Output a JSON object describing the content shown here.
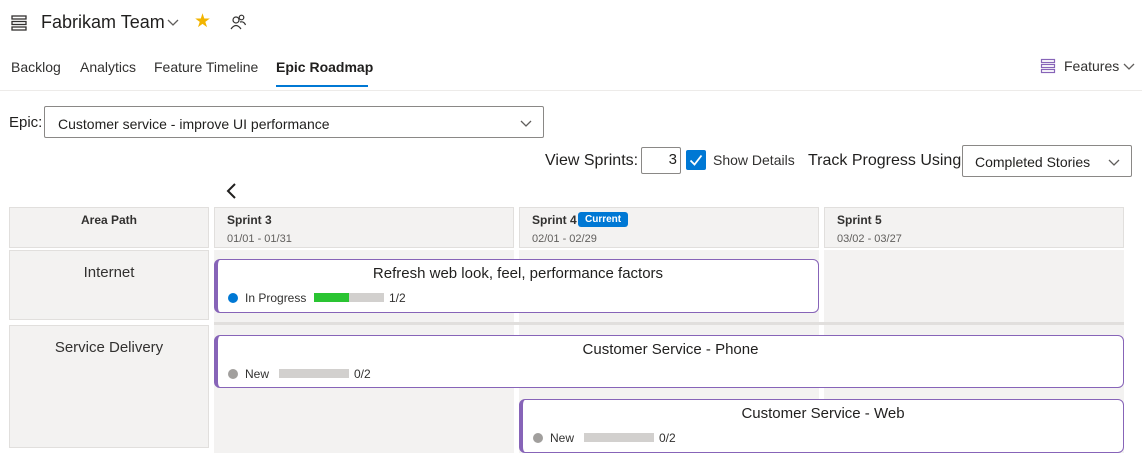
{
  "header": {
    "team_name": "Fabrikam Team",
    "tabs": [
      {
        "label": "Backlog",
        "active": false
      },
      {
        "label": "Analytics",
        "active": false
      },
      {
        "label": "Feature Timeline",
        "active": false
      },
      {
        "label": "Epic Roadmap",
        "active": true
      }
    ],
    "features_label": "Features",
    "icons": {
      "team": "backlog-list-icon",
      "favorite": "star-icon",
      "members": "people-icon",
      "features": "features-list-icon"
    },
    "accent_color": "#0078d4"
  },
  "epic": {
    "label": "Epic:",
    "selected": "Customer service - improve UI performance"
  },
  "controls": {
    "view_sprints_label": "View Sprints:",
    "view_sprints_value": "3",
    "show_details_checked": true,
    "show_details_label": "Show Details",
    "track_progress_label": "Track Progress Using:",
    "track_progress_value": "Completed Stories"
  },
  "grid": {
    "area_header": "Area Path",
    "sprints": [
      {
        "name": "Sprint 3",
        "dates": "01/01 - 01/31",
        "current": false
      },
      {
        "name": "Sprint 4",
        "dates": "02/01 - 02/29",
        "current": true,
        "badge": "Current"
      },
      {
        "name": "Sprint 5",
        "dates": "03/02 - 03/27",
        "current": false
      }
    ],
    "areas": [
      {
        "name": "Internet",
        "cards": [
          {
            "title": "Refresh web look, feel, performance factors",
            "state": "In Progress",
            "state_color": "#0078d4",
            "progress": 0.5,
            "progress_text": "1/2"
          }
        ]
      },
      {
        "name": "Service Delivery",
        "cards": [
          {
            "title": "Customer Service - Phone",
            "state": "New",
            "state_color": "#a19f9d",
            "progress": 0.0,
            "progress_text": "0/2"
          },
          {
            "title": "Customer Service - Web",
            "state": "New",
            "state_color": "#a19f9d",
            "progress": 0.0,
            "progress_text": "0/2"
          }
        ]
      }
    ],
    "card_border_color": "#8764b8",
    "progress_color": "#2ac432"
  }
}
